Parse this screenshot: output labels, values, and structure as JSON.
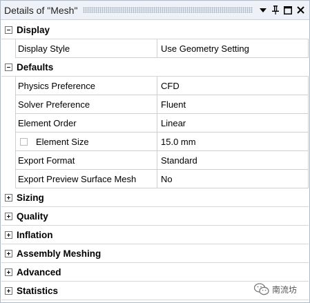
{
  "window": {
    "title": "Details of \"Mesh\"",
    "icons": [
      "dropdown-arrow-icon",
      "pin-icon",
      "maximize-icon",
      "close-icon"
    ]
  },
  "groups": [
    {
      "label": "Display",
      "expanded": true,
      "properties": [
        {
          "name": "Display Style",
          "value": "Use Geometry Setting"
        }
      ]
    },
    {
      "label": "Defaults",
      "expanded": true,
      "properties": [
        {
          "name": "Physics Preference",
          "value": "CFD"
        },
        {
          "name": "Solver Preference",
          "value": "Fluent"
        },
        {
          "name": "Element Order",
          "value": "Linear"
        },
        {
          "name": "Element Size",
          "value": "15.0 mm",
          "checkbox": true
        },
        {
          "name": "Export Format",
          "value": "Standard"
        },
        {
          "name": "Export Preview Surface Mesh",
          "value": "No"
        }
      ]
    },
    {
      "label": "Sizing",
      "expanded": false
    },
    {
      "label": "Quality",
      "expanded": false
    },
    {
      "label": "Inflation",
      "expanded": false
    },
    {
      "label": "Assembly Meshing",
      "expanded": false
    },
    {
      "label": "Advanced",
      "expanded": false
    },
    {
      "label": "Statistics",
      "expanded": false
    }
  ],
  "watermark": {
    "text": "南流坊",
    "icon": "wechat-icon"
  },
  "colors": {
    "titlebar": "#eef2f8",
    "border": "#aeb9c8",
    "grid": "#cfcfcf"
  }
}
